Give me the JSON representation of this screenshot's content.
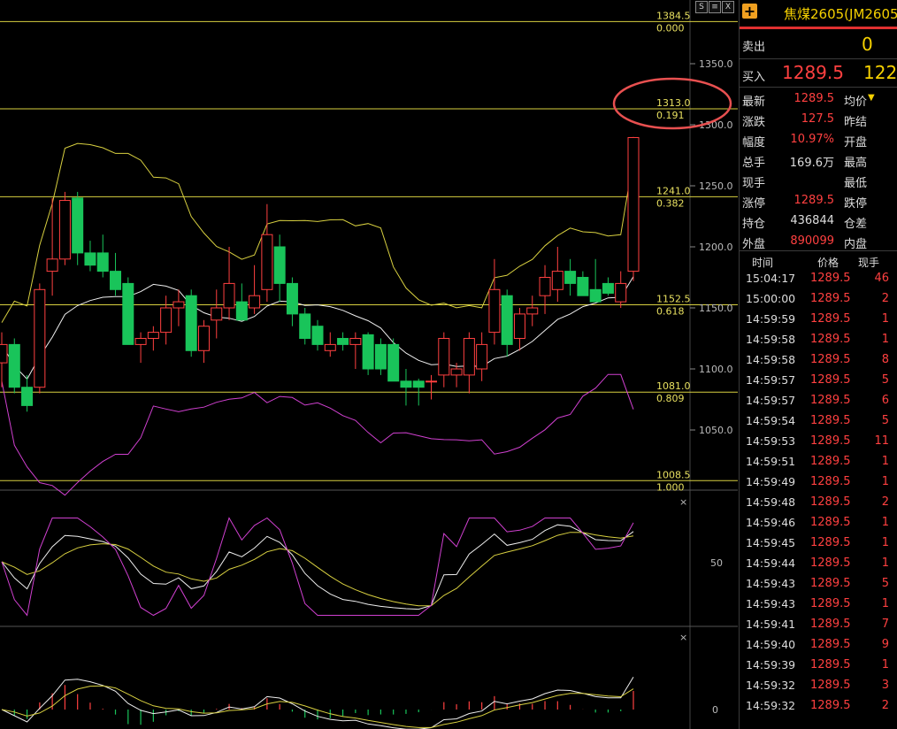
{
  "toolbar": {
    "btn_s": "S",
    "btn_e": "≡",
    "btn_x": "X"
  },
  "axis": {
    "price_ticks": [
      "1350.0",
      "1300.0",
      "1250.0",
      "1200.0",
      "1150.0",
      "1100.0",
      "1050.0"
    ],
    "ind1_tick": "50",
    "ind2_tick": "0"
  },
  "fib_levels": [
    {
      "price": "1384.5",
      "ratio": "0.000"
    },
    {
      "price": "1313.0",
      "ratio": "0.191"
    },
    {
      "price": "1241.0",
      "ratio": "0.382"
    },
    {
      "price": "1152.5",
      "ratio": "0.618"
    },
    {
      "price": "1081.0",
      "ratio": "0.809"
    },
    {
      "price": "1008.5",
      "ratio": "1.000"
    }
  ],
  "quote": {
    "symbol": "焦煤2605(JM2605",
    "sell_label": "卖出",
    "sell_value": "0",
    "buy_label": "买入",
    "buy_price": "1289.5",
    "buy_vol": "122",
    "fields": [
      {
        "label": "最新",
        "value": "1289.5",
        "label2": "均价"
      },
      {
        "label": "涨跌",
        "value": "127.5",
        "label2": "昨结"
      },
      {
        "label": "幅度",
        "value": "10.97%",
        "label2": "开盘"
      },
      {
        "label": "总手",
        "value": "169.6万",
        "label2": "最高"
      },
      {
        "label": "现手",
        "value": "",
        "label2": "最低"
      },
      {
        "label": "涨停",
        "value": "1289.5",
        "label2": "跌停"
      },
      {
        "label": "持仓",
        "value": "436844",
        "label2": "仓差"
      },
      {
        "label": "外盘",
        "value": "890099",
        "label2": "内盘"
      }
    ]
  },
  "ticks_header": {
    "time": "时间",
    "price": "价格",
    "vol": "现手"
  },
  "ticks": [
    {
      "time": "15:04:17",
      "price": "1289.5",
      "vol": "46"
    },
    {
      "time": "15:00:00",
      "price": "1289.5",
      "vol": "2"
    },
    {
      "time": "14:59:59",
      "price": "1289.5",
      "vol": "1"
    },
    {
      "time": "14:59:58",
      "price": "1289.5",
      "vol": "1"
    },
    {
      "time": "14:59:58",
      "price": "1289.5",
      "vol": "8"
    },
    {
      "time": "14:59:57",
      "price": "1289.5",
      "vol": "5"
    },
    {
      "time": "14:59:57",
      "price": "1289.5",
      "vol": "6"
    },
    {
      "time": "14:59:54",
      "price": "1289.5",
      "vol": "5"
    },
    {
      "time": "14:59:53",
      "price": "1289.5",
      "vol": "11"
    },
    {
      "time": "14:59:51",
      "price": "1289.5",
      "vol": "1"
    },
    {
      "time": "14:59:49",
      "price": "1289.5",
      "vol": "1"
    },
    {
      "time": "14:59:48",
      "price": "1289.5",
      "vol": "2"
    },
    {
      "time": "14:59:46",
      "price": "1289.5",
      "vol": "1"
    },
    {
      "time": "14:59:45",
      "price": "1289.5",
      "vol": "1"
    },
    {
      "time": "14:59:44",
      "price": "1289.5",
      "vol": "1"
    },
    {
      "time": "14:59:43",
      "price": "1289.5",
      "vol": "5"
    },
    {
      "time": "14:59:43",
      "price": "1289.5",
      "vol": "1"
    },
    {
      "time": "14:59:41",
      "price": "1289.5",
      "vol": "7"
    },
    {
      "time": "14:59:40",
      "price": "1289.5",
      "vol": "9"
    },
    {
      "time": "14:59:39",
      "price": "1289.5",
      "vol": "1"
    },
    {
      "time": "14:59:32",
      "price": "1289.5",
      "vol": "3"
    },
    {
      "time": "14:59:32",
      "price": "1289.5",
      "vol": "2"
    }
  ],
  "colors": {
    "up": "#ff4040",
    "down": "#19c45a",
    "fib": "#e8e060",
    "circle": "#e85050"
  },
  "candles": [
    {
      "o": 1105,
      "h": 1130,
      "l": 1085,
      "c": 1120
    },
    {
      "o": 1120,
      "h": 1125,
      "l": 1080,
      "c": 1085
    },
    {
      "o": 1085,
      "h": 1095,
      "l": 1065,
      "c": 1070
    },
    {
      "o": 1085,
      "h": 1170,
      "l": 1080,
      "c": 1165
    },
    {
      "o": 1180,
      "h": 1240,
      "l": 1160,
      "c": 1190
    },
    {
      "o": 1190,
      "h": 1245,
      "l": 1185,
      "c": 1238
    },
    {
      "o": 1240,
      "h": 1245,
      "l": 1185,
      "c": 1195
    },
    {
      "o": 1195,
      "h": 1205,
      "l": 1180,
      "c": 1185
    },
    {
      "o": 1195,
      "h": 1210,
      "l": 1175,
      "c": 1180
    },
    {
      "o": 1180,
      "h": 1195,
      "l": 1160,
      "c": 1165
    },
    {
      "o": 1170,
      "h": 1175,
      "l": 1120,
      "c": 1120
    },
    {
      "o": 1120,
      "h": 1130,
      "l": 1105,
      "c": 1125
    },
    {
      "o": 1125,
      "h": 1135,
      "l": 1115,
      "c": 1130
    },
    {
      "o": 1130,
      "h": 1160,
      "l": 1120,
      "c": 1150
    },
    {
      "o": 1150,
      "h": 1165,
      "l": 1135,
      "c": 1155
    },
    {
      "o": 1160,
      "h": 1165,
      "l": 1110,
      "c": 1115
    },
    {
      "o": 1115,
      "h": 1140,
      "l": 1105,
      "c": 1135
    },
    {
      "o": 1140,
      "h": 1165,
      "l": 1125,
      "c": 1150
    },
    {
      "o": 1150,
      "h": 1200,
      "l": 1140,
      "c": 1170
    },
    {
      "o": 1155,
      "h": 1170,
      "l": 1140,
      "c": 1140
    },
    {
      "o": 1150,
      "h": 1185,
      "l": 1145,
      "c": 1160
    },
    {
      "o": 1165,
      "h": 1235,
      "l": 1155,
      "c": 1210
    },
    {
      "o": 1200,
      "h": 1210,
      "l": 1155,
      "c": 1170
    },
    {
      "o": 1170,
      "h": 1175,
      "l": 1135,
      "c": 1145
    },
    {
      "o": 1145,
      "h": 1150,
      "l": 1120,
      "c": 1125
    },
    {
      "o": 1135,
      "h": 1140,
      "l": 1115,
      "c": 1120
    },
    {
      "o": 1115,
      "h": 1130,
      "l": 1110,
      "c": 1120
    },
    {
      "o": 1125,
      "h": 1130,
      "l": 1115,
      "c": 1120
    },
    {
      "o": 1120,
      "h": 1130,
      "l": 1100,
      "c": 1125
    },
    {
      "o": 1128,
      "h": 1130,
      "l": 1095,
      "c": 1100
    },
    {
      "o": 1120,
      "h": 1125,
      "l": 1095,
      "c": 1100
    },
    {
      "o": 1120,
      "h": 1125,
      "l": 1090,
      "c": 1090
    },
    {
      "o": 1090,
      "h": 1100,
      "l": 1070,
      "c": 1085
    },
    {
      "o": 1090,
      "h": 1092,
      "l": 1070,
      "c": 1085
    },
    {
      "o": 1090,
      "h": 1095,
      "l": 1075,
      "c": 1090
    },
    {
      "o": 1095,
      "h": 1130,
      "l": 1085,
      "c": 1125
    },
    {
      "o": 1095,
      "h": 1105,
      "l": 1085,
      "c": 1100
    },
    {
      "o": 1095,
      "h": 1130,
      "l": 1080,
      "c": 1125
    },
    {
      "o": 1100,
      "h": 1130,
      "l": 1090,
      "c": 1120
    },
    {
      "o": 1130,
      "h": 1190,
      "l": 1120,
      "c": 1165
    },
    {
      "o": 1160,
      "h": 1165,
      "l": 1110,
      "c": 1120
    },
    {
      "o": 1125,
      "h": 1150,
      "l": 1115,
      "c": 1145
    },
    {
      "o": 1145,
      "h": 1160,
      "l": 1135,
      "c": 1150
    },
    {
      "o": 1160,
      "h": 1185,
      "l": 1145,
      "c": 1175
    },
    {
      "o": 1165,
      "h": 1200,
      "l": 1155,
      "c": 1180
    },
    {
      "o": 1180,
      "h": 1190,
      "l": 1160,
      "c": 1170
    },
    {
      "o": 1175,
      "h": 1180,
      "l": 1160,
      "c": 1160
    },
    {
      "o": 1165,
      "h": 1190,
      "l": 1155,
      "c": 1155
    },
    {
      "o": 1170,
      "h": 1175,
      "l": 1160,
      "c": 1162
    },
    {
      "o": 1155,
      "h": 1180,
      "l": 1150,
      "c": 1170
    },
    {
      "o": 1180,
      "h": 1290,
      "l": 1172,
      "c": 1289.5
    }
  ]
}
